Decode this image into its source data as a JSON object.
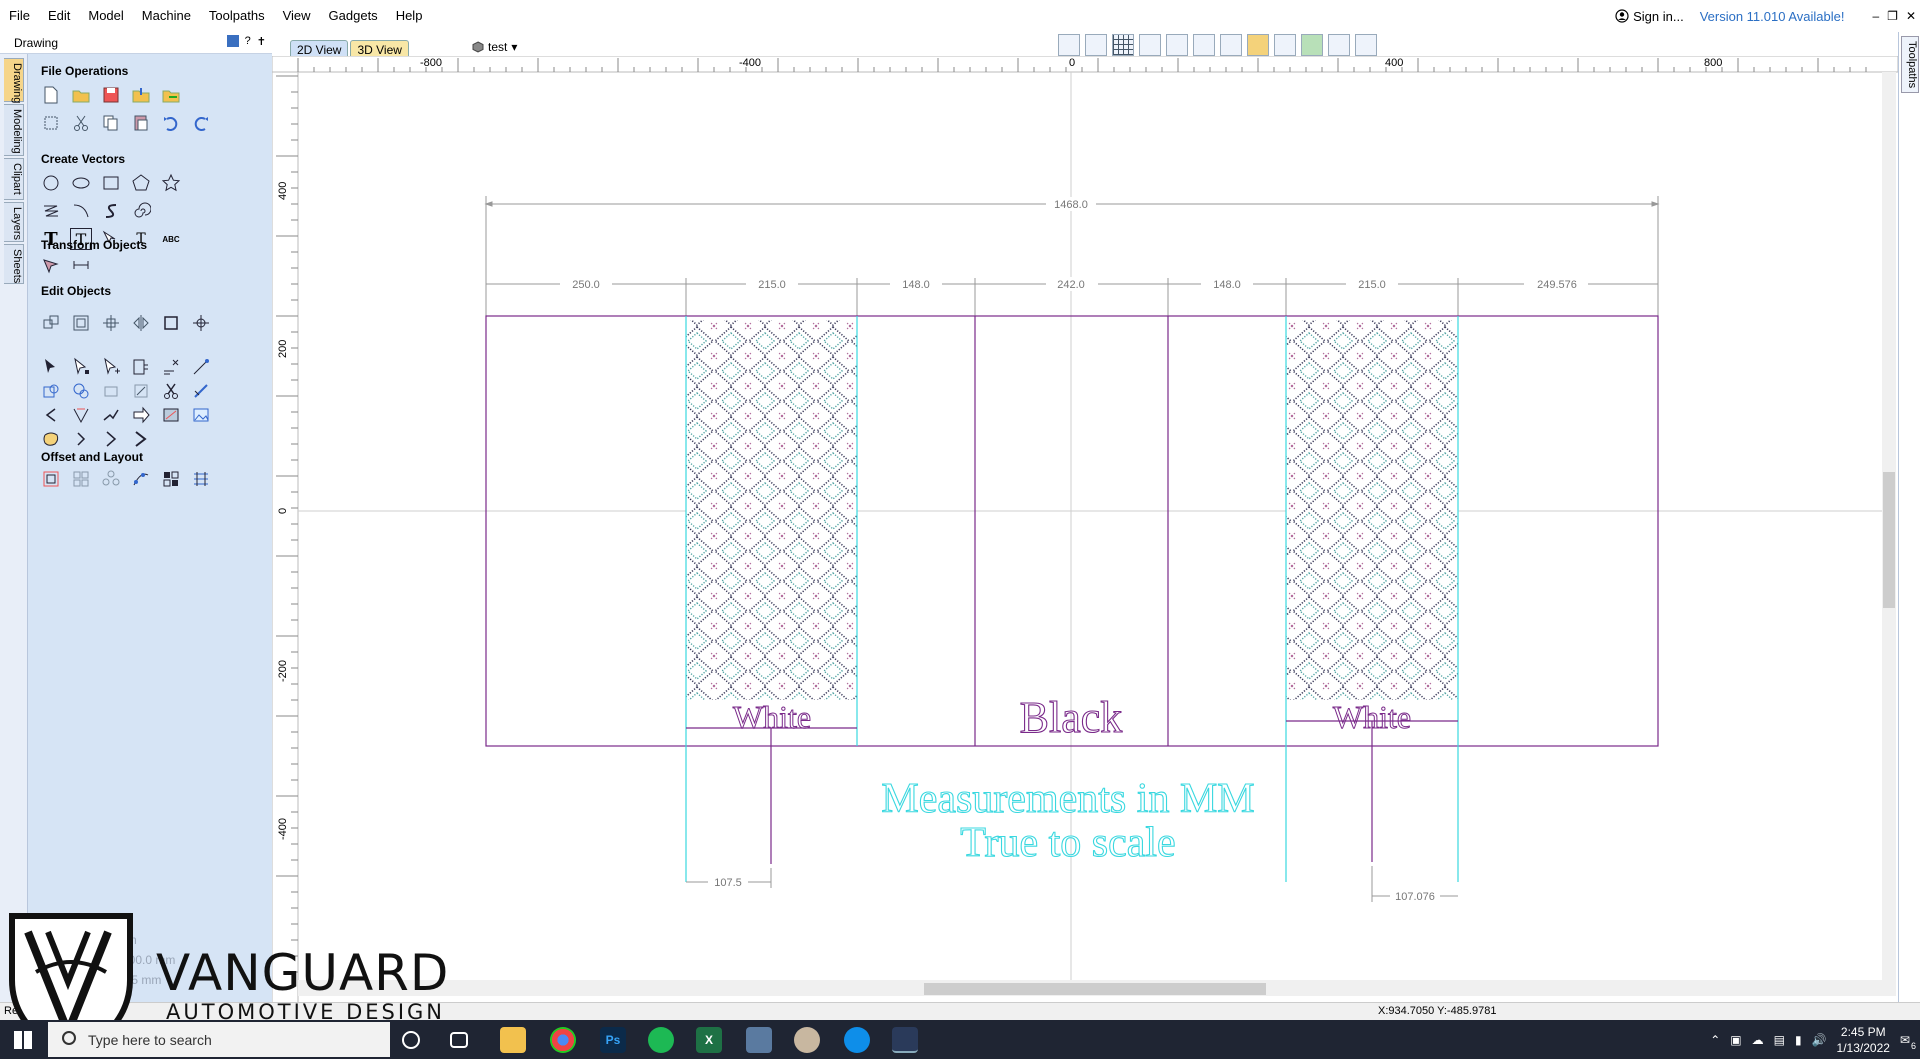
{
  "menubar": {
    "items": [
      "File",
      "Edit",
      "Model",
      "Machine",
      "Toolpaths",
      "View",
      "Gadgets",
      "Help"
    ],
    "sign_in": "Sign in...",
    "version": "Version 11.010 Available!"
  },
  "panel": {
    "title": "Drawing",
    "header_icons": [
      "?"
    ],
    "side_tabs": [
      "Drawing",
      "Modeling",
      "Clipart",
      "Layers",
      "Sheets"
    ],
    "sections": {
      "file_operations": "File Operations",
      "create_vectors": "Create Vectors",
      "transform_objects": "Transform Objects",
      "edit_objects": "Edit Objects",
      "offset_layout": "Offset and Layout"
    },
    "selection_info": {
      "label_suffix": "ns",
      "width": "Width  .000.0 mm",
      "height": "000.0 mm",
      "z": ".5 mm"
    }
  },
  "views": {
    "tab_2d": "2D View",
    "tab_3d": "3D View",
    "doc": "test"
  },
  "right_tab": "Toolpaths",
  "rulers": {
    "h_ticks": [
      "-800",
      "-400",
      "0",
      "400",
      "800"
    ],
    "v_ticks": [
      "400",
      "200",
      "0",
      "-200",
      "-400"
    ]
  },
  "drawing": {
    "total_width": "1468.0",
    "segments": [
      "250.0",
      "215.0",
      "148.0",
      "242.0",
      "148.0",
      "215.0",
      "249.576"
    ],
    "left_offset": "107.5",
    "right_offset": "107.076",
    "label_left": "White",
    "label_center": "Black",
    "label_right": "White",
    "note_line1": "Measurements in MM",
    "note_line2": "True to scale"
  },
  "status": {
    "text": "Ready",
    "coords": "X:934.7050 Y:-485.9781"
  },
  "logo": {
    "title": "VANGUARD",
    "subtitle": "AUTOMOTIVE DESIGN"
  },
  "taskbar": {
    "search_placeholder": "Type here to search",
    "time": "2:45 PM",
    "date": "1/13/2022",
    "notification_count": "6"
  },
  "colors": {
    "drawing_line": "#7a2a8a",
    "cyan": "#3ad8e0",
    "dimension": "#8a8a8a",
    "panel_bg": "#d6e4f5"
  }
}
